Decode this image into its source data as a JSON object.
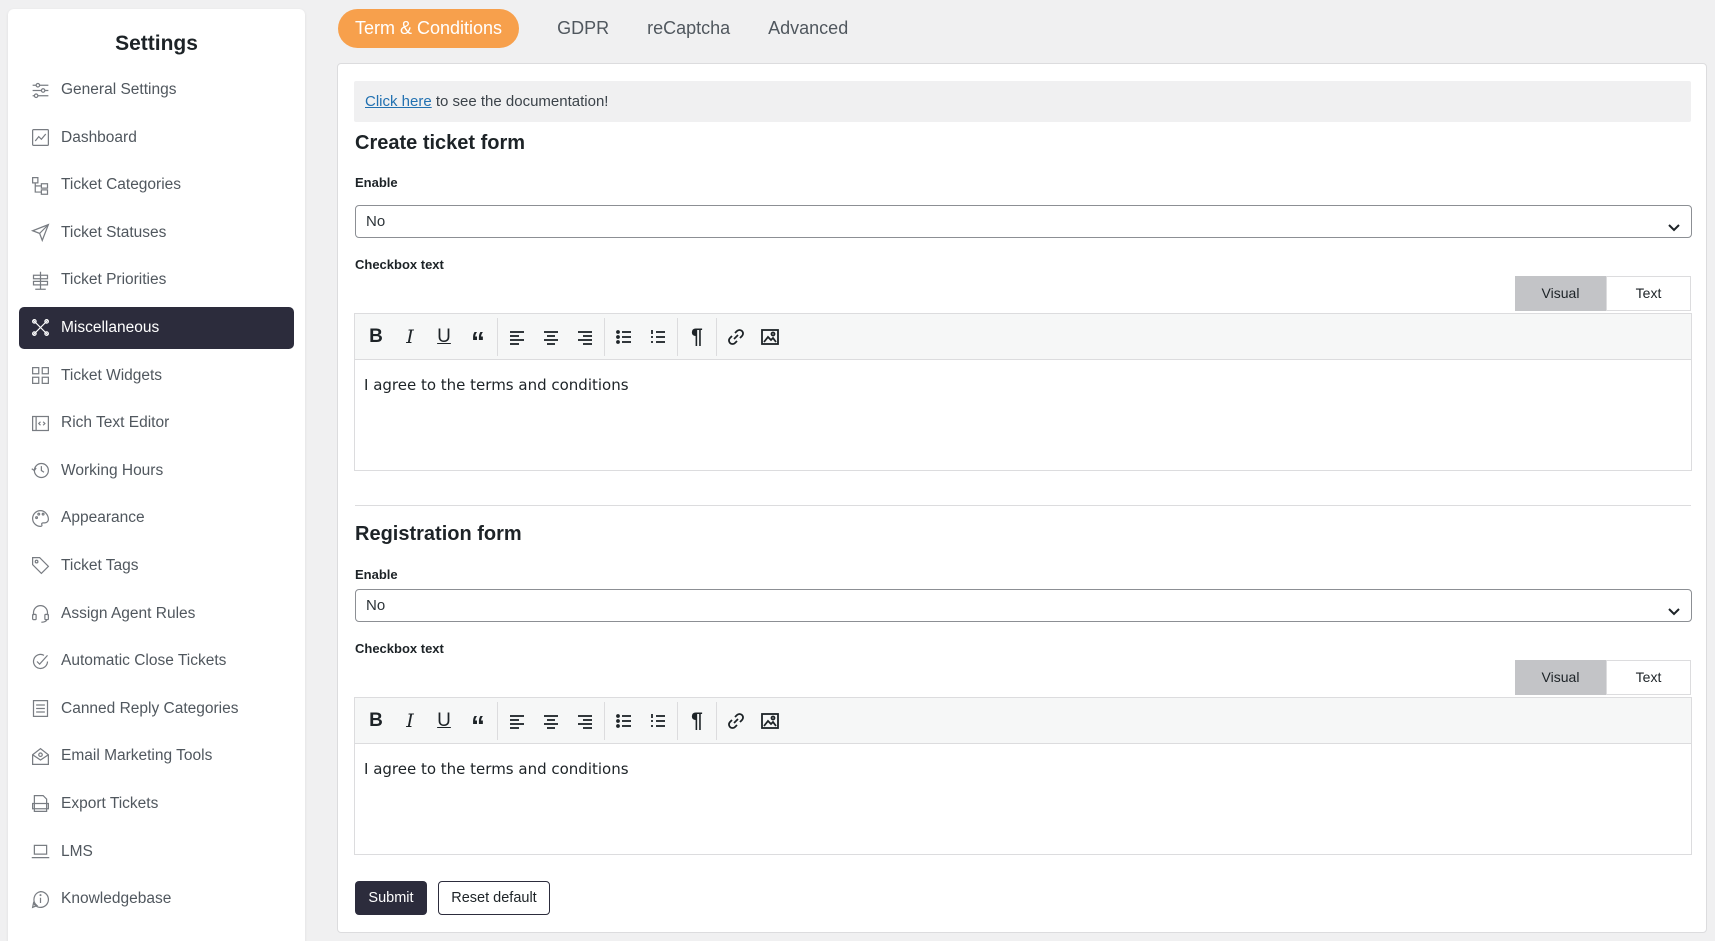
{
  "sidebar": {
    "title": "Settings",
    "items": [
      {
        "label": "General Settings",
        "icon": "sliders-icon",
        "active": false
      },
      {
        "label": "Dashboard",
        "icon": "dashboard-chart-icon",
        "active": false
      },
      {
        "label": "Ticket Categories",
        "icon": "category-tree-icon",
        "active": false
      },
      {
        "label": "Ticket Statuses",
        "icon": "paper-plane-icon",
        "active": false
      },
      {
        "label": "Ticket Priorities",
        "icon": "priority-sign-icon",
        "active": false
      },
      {
        "label": "Miscellaneous",
        "icon": "tools-icon",
        "active": true
      },
      {
        "label": "Ticket Widgets",
        "icon": "widgets-grid-icon",
        "active": false
      },
      {
        "label": "Rich Text Editor",
        "icon": "code-editor-icon",
        "active": false
      },
      {
        "label": "Working Hours",
        "icon": "clock-history-icon",
        "active": false
      },
      {
        "label": "Appearance",
        "icon": "palette-icon",
        "active": false
      },
      {
        "label": "Ticket Tags",
        "icon": "tag-icon",
        "active": false
      },
      {
        "label": "Assign Agent Rules",
        "icon": "headset-icon",
        "active": false
      },
      {
        "label": "Automatic Close Tickets",
        "icon": "check-circle-icon",
        "active": false
      },
      {
        "label": "Canned Reply Categories",
        "icon": "document-list-icon",
        "active": false
      },
      {
        "label": "Email Marketing Tools",
        "icon": "email-icon",
        "active": false
      },
      {
        "label": "Export Tickets",
        "icon": "csv-file-icon",
        "active": false
      },
      {
        "label": "LMS",
        "icon": "laptop-icon",
        "active": false
      },
      {
        "label": "Knowledgebase",
        "icon": "info-chat-icon",
        "active": false
      }
    ]
  },
  "tabs": [
    {
      "label": "Term & Conditions",
      "active": true
    },
    {
      "label": "GDPR",
      "active": false
    },
    {
      "label": "reCaptcha",
      "active": false
    },
    {
      "label": "Advanced",
      "active": false
    }
  ],
  "doc_note": {
    "link": "Click here",
    "text": " to see the documentation!"
  },
  "create_form": {
    "title": "Create ticket form",
    "enable_label": "Enable",
    "enable_value": "No",
    "checkbox_label": "Checkbox text",
    "visual_label": "Visual",
    "text_label": "Text",
    "content": "I agree to the terms and conditions"
  },
  "registration_form": {
    "title": "Registration form",
    "enable_label": "Enable",
    "enable_value": "No",
    "checkbox_label": "Checkbox text",
    "visual_label": "Visual",
    "text_label": "Text",
    "content": "I agree to the terms and conditions"
  },
  "toolbar": {
    "bold": "B",
    "italic": "I",
    "underline": "U",
    "quote": "“",
    "paragraph": "¶"
  },
  "actions": {
    "submit": "Submit",
    "reset": "Reset default"
  }
}
